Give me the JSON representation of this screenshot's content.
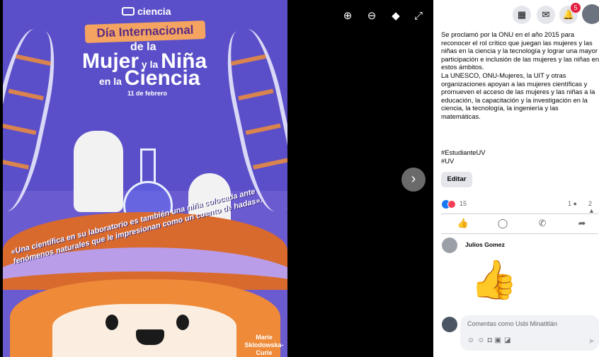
{
  "poster": {
    "brand": "ciencia",
    "ribbon_title": "Día Internacional",
    "line_de_la": "de la",
    "line_mujer_a": "Mujer",
    "line_mujer_b": " y la ",
    "line_mujer_c": "Niña",
    "line_ciencia_a": "en la ",
    "line_ciencia_b": "Ciencia",
    "date": "11 de febrero",
    "quote": "«Una científica en su laboratorio es también una niña colocada ante fenómenos naturales que le impresionan como un cuento de hadas».",
    "signature_first": "Marie",
    "signature_last": "Sklodowska-Curie"
  },
  "viewer": {
    "zoom_in_icon": "zoom-in-icon",
    "zoom_out_icon": "zoom-out-icon",
    "tag_icon": "tag-icon",
    "fullscreen_icon": "fullscreen-icon",
    "next_icon": "chevron-right-icon"
  },
  "topbar": {
    "notifications_badge": "5"
  },
  "post": {
    "paragraph1": "Se proclamó por la ONU en el año 2015 para reconocer el rol crítico que juegan las mujeres y las niñas en la ciencia y la tecnología y lograr una mayor participación e inclusión de las mujeres y las niñas en estos ámbitos.",
    "paragraph2": "La UNESCO, ONU-Mujeres, la UIT y otras organizaciones apoyan a las mujeres científicas y promueven el acceso de las mujeres y las niñas a la educación, la capacitación y la investigación en la ciencia, la tecnología, la ingeniería y las matemáticas.",
    "hashtag1": "#EstudianteUV",
    "hashtag2": "#UV",
    "edit_label": "Editar"
  },
  "reactions": {
    "count": "15",
    "comments": "1",
    "shares": "2"
  },
  "comment": {
    "author": "Julios Gomez"
  },
  "composer": {
    "placeholder": "Comentas como Usbi Minatitlán"
  },
  "colors": {
    "poster_bg": "#5a4fc8",
    "accent_orange": "#f08d3b",
    "fb_blue": "#1877f2",
    "badge_red": "#e41e3f"
  }
}
